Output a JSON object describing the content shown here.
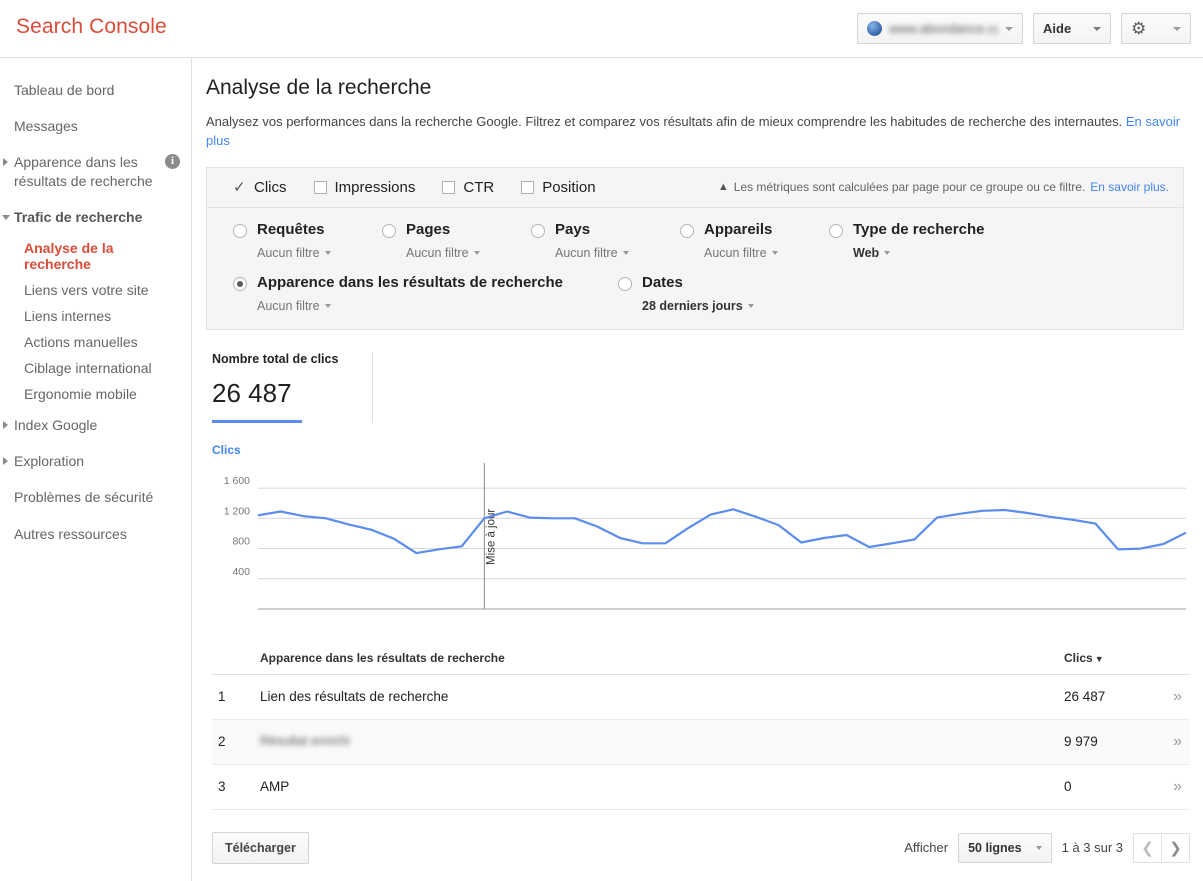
{
  "topbar": {
    "brand": "Search Console",
    "site_selector_value": "www.abondance.com",
    "help_label": "Aide",
    "gear_icon": "gear-icon"
  },
  "sidebar": {
    "items": [
      {
        "label": "Tableau de bord",
        "type": "plain"
      },
      {
        "label": "Messages",
        "type": "plain"
      },
      {
        "label": "Apparence dans les résultats de recherche",
        "type": "expandable",
        "info": "i"
      },
      {
        "label": "Trafic de recherche",
        "type": "expanded"
      },
      {
        "label": "Index Google",
        "type": "expandable"
      },
      {
        "label": "Exploration",
        "type": "expandable"
      },
      {
        "label": "Problèmes de sécurité",
        "type": "plain"
      },
      {
        "label": "Autres ressources",
        "type": "plain"
      }
    ],
    "sub_items": [
      {
        "label": "Analyse de la recherche",
        "active": true
      },
      {
        "label": "Liens vers votre site",
        "active": false
      },
      {
        "label": "Liens internes",
        "active": false
      },
      {
        "label": "Actions manuelles",
        "active": false
      },
      {
        "label": "Ciblage international",
        "active": false
      },
      {
        "label": "Ergonomie mobile",
        "active": false
      }
    ]
  },
  "main": {
    "title": "Analyse de la recherche",
    "description": "Analysez vos performances dans la recherche Google. Filtrez et comparez vos résultats afin de mieux comprendre les habitudes de recherche des internautes.",
    "description_link": "En savoir plus"
  },
  "filters": {
    "metrics": [
      {
        "label": "Clics",
        "checked": true
      },
      {
        "label": "Impressions",
        "checked": false
      },
      {
        "label": "CTR",
        "checked": false
      },
      {
        "label": "Position",
        "checked": false
      }
    ],
    "note_text": "Les métriques sont calculées par page pour ce groupe ou ce filtre.",
    "note_link": "En savoir plus.",
    "dimensions_row1": [
      {
        "label": "Requêtes",
        "filter": "Aucun filtre",
        "selected": false,
        "strong_filter": false
      },
      {
        "label": "Pages",
        "filter": "Aucun filtre",
        "selected": false,
        "strong_filter": false
      },
      {
        "label": "Pays",
        "filter": "Aucun filtre",
        "selected": false,
        "strong_filter": false
      },
      {
        "label": "Appareils",
        "filter": "Aucun filtre",
        "selected": false,
        "strong_filter": false
      },
      {
        "label": "Type de recherche",
        "filter": "Web",
        "selected": false,
        "strong_filter": true
      }
    ],
    "dimensions_row2": [
      {
        "label": "Apparence dans les résultats de recherche",
        "filter": "Aucun filtre",
        "selected": true,
        "strong_filter": false
      },
      {
        "label": "Dates",
        "filter": "28 derniers jours",
        "selected": false,
        "strong_filter": true
      }
    ]
  },
  "totals": {
    "label": "Nombre total de clics",
    "value": "26 487"
  },
  "chart_data": {
    "type": "line",
    "title": "",
    "legend": "Clics",
    "legend_position": "top-left",
    "xlabel": "",
    "ylabel": "",
    "ylim": [
      0,
      1800
    ],
    "yticks": [
      400,
      800,
      1200,
      1600
    ],
    "ytick_labels": [
      "400",
      "800",
      "1 200",
      "1 600"
    ],
    "grid": true,
    "annotation": {
      "label": "Mise à jour",
      "x_index": 10
    },
    "series": [
      {
        "name": "Clics",
        "color": "#5b8def",
        "values": [
          1240,
          1290,
          1230,
          1200,
          1120,
          1050,
          930,
          740,
          790,
          830,
          1200,
          1290,
          1210,
          1200,
          1200,
          1090,
          940,
          870,
          870,
          1070,
          1250,
          1320,
          1220,
          1110,
          880,
          940,
          980,
          820,
          870,
          920,
          1210,
          1260,
          1300,
          1310,
          1270,
          1220,
          1180,
          1130,
          790,
          800,
          860,
          1010
        ]
      }
    ]
  },
  "table": {
    "columns": [
      "",
      "Apparence dans les résultats de recherche",
      "Clics",
      ""
    ],
    "sort_column": "Clics",
    "sort_direction": "desc",
    "rows": [
      {
        "index": "1",
        "name": "Lien des résultats de recherche",
        "blurred": false,
        "clicks": "26 487"
      },
      {
        "index": "2",
        "name": "Résultat enrichi",
        "blurred": true,
        "clicks": "9 979"
      },
      {
        "index": "3",
        "name": "AMP",
        "blurred": false,
        "clicks": "0"
      }
    ]
  },
  "footer": {
    "download_label": "Télécharger",
    "show_label": "Afficher",
    "rows_value": "50 lignes",
    "range_label": "1 à 3 sur 3",
    "prev_icon": "chevron-left-icon",
    "next_icon": "chevron-right-icon"
  },
  "colors": {
    "brand": "#dd4b39",
    "link": "#4285f4",
    "chart_line": "#5b8def",
    "panel_bg": "#f5f5f5"
  }
}
